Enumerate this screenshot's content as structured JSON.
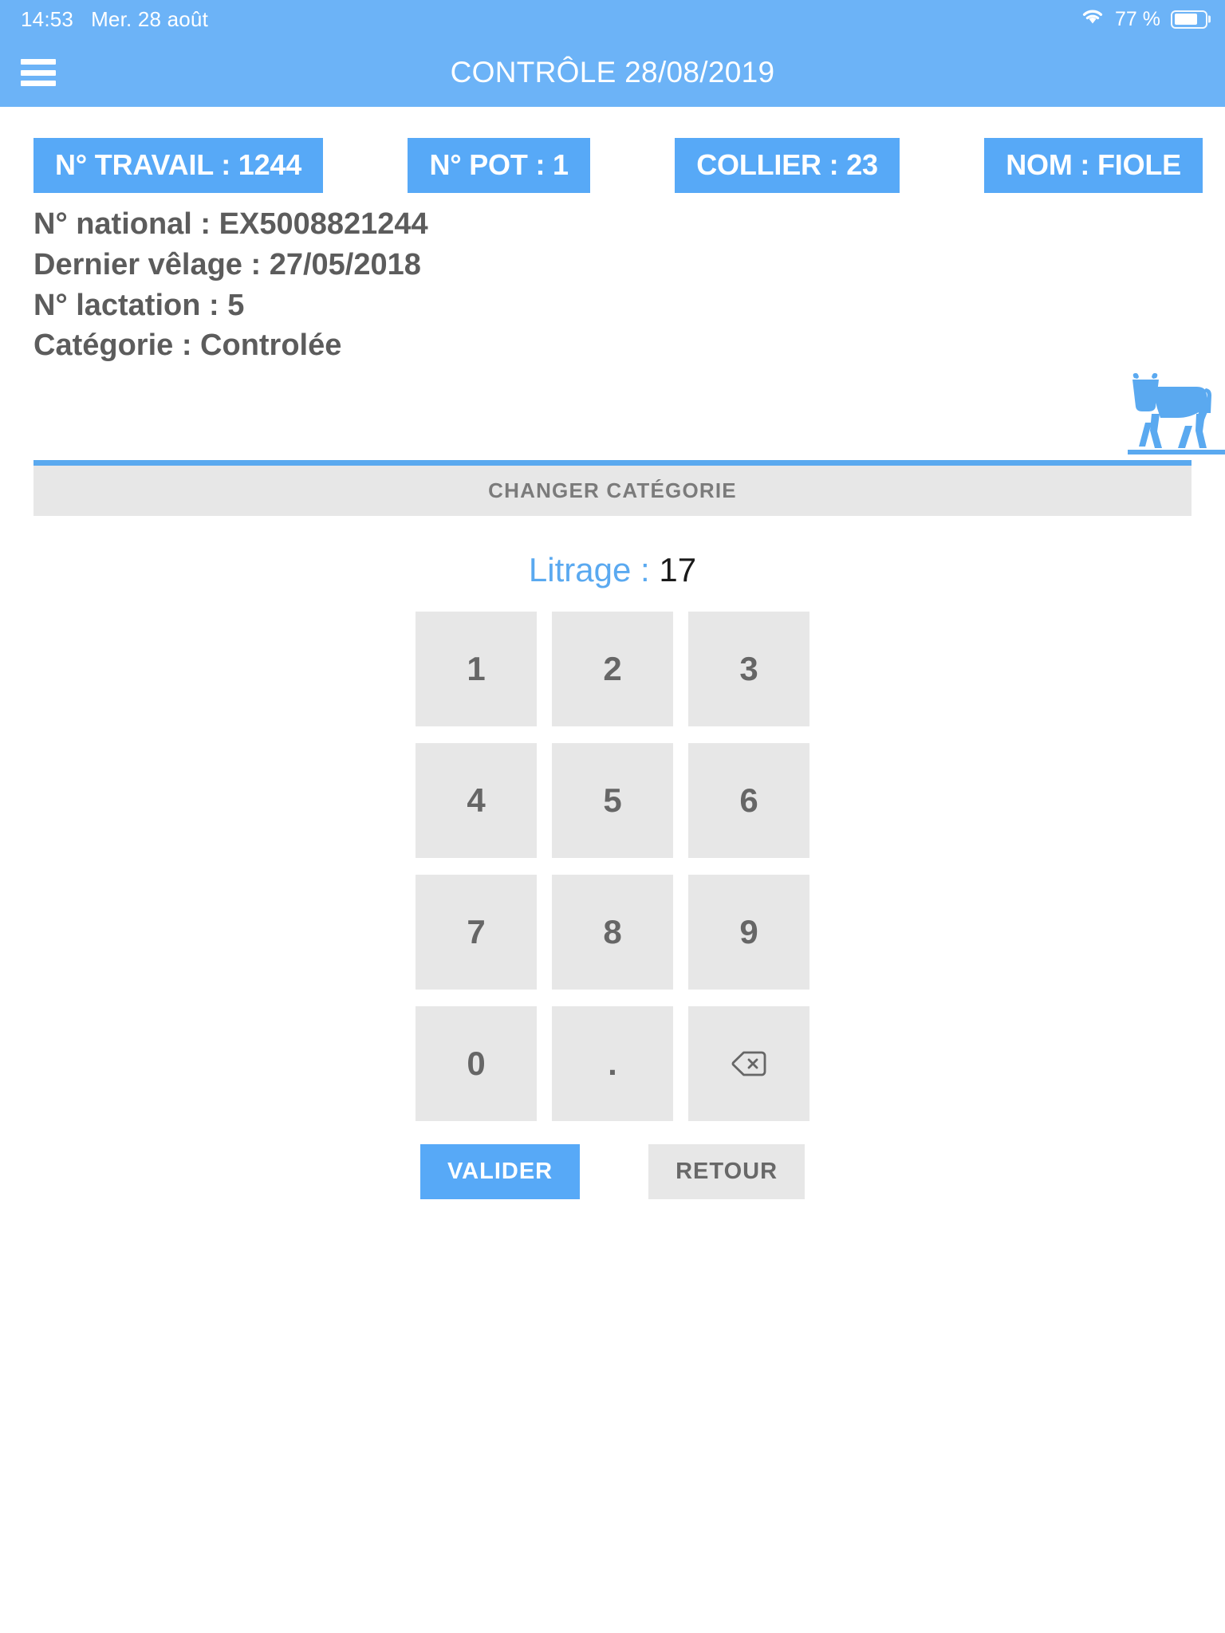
{
  "status_bar": {
    "time": "14:53",
    "date": "Mer. 28 août",
    "battery_percent": "77 %",
    "wifi_icon": "wifi-icon",
    "battery_icon": "battery-icon"
  },
  "app_bar": {
    "menu_icon": "hamburger-menu-icon",
    "title": "CONTRÔLE 28/08/2019"
  },
  "chips": [
    {
      "label": "N° TRAVAIL : 1244",
      "name": "chip-numero-travail"
    },
    {
      "label": "N° POT : 1",
      "name": "chip-numero-pot"
    },
    {
      "label": "COLLIER : 23",
      "name": "chip-collier"
    },
    {
      "label": "NOM : FIOLE",
      "name": "chip-nom"
    }
  ],
  "details": [
    "N° national : EX5008821244",
    "Dernier vêlage : 27/05/2018",
    "N° lactation : 5",
    "Catégorie : Controlée"
  ],
  "cow_icon": "cow-icon",
  "changer_categorie": {
    "label": "CHANGER CATÉGORIE"
  },
  "litrage": {
    "label": "Litrage : ",
    "value": "17"
  },
  "keypad": {
    "keys": [
      {
        "label": "1",
        "name": "key-1"
      },
      {
        "label": "2",
        "name": "key-2"
      },
      {
        "label": "3",
        "name": "key-3"
      },
      {
        "label": "4",
        "name": "key-4"
      },
      {
        "label": "5",
        "name": "key-5"
      },
      {
        "label": "6",
        "name": "key-6"
      },
      {
        "label": "7",
        "name": "key-7"
      },
      {
        "label": "8",
        "name": "key-8"
      },
      {
        "label": "9",
        "name": "key-9"
      },
      {
        "label": "0",
        "name": "key-0"
      },
      {
        "label": ".",
        "name": "key-decimal"
      },
      {
        "label": "",
        "name": "key-backspace",
        "icon": "backspace-icon"
      }
    ]
  },
  "actions": {
    "validate_label": "VALIDER",
    "back_label": "RETOUR"
  },
  "colors": {
    "brand_blue": "#6cb3f7",
    "chip_blue": "#57a9f7",
    "key_grey": "#e7e7e7",
    "text_grey": "#5c5c5c",
    "litrage_blue": "#5aa9f0"
  }
}
